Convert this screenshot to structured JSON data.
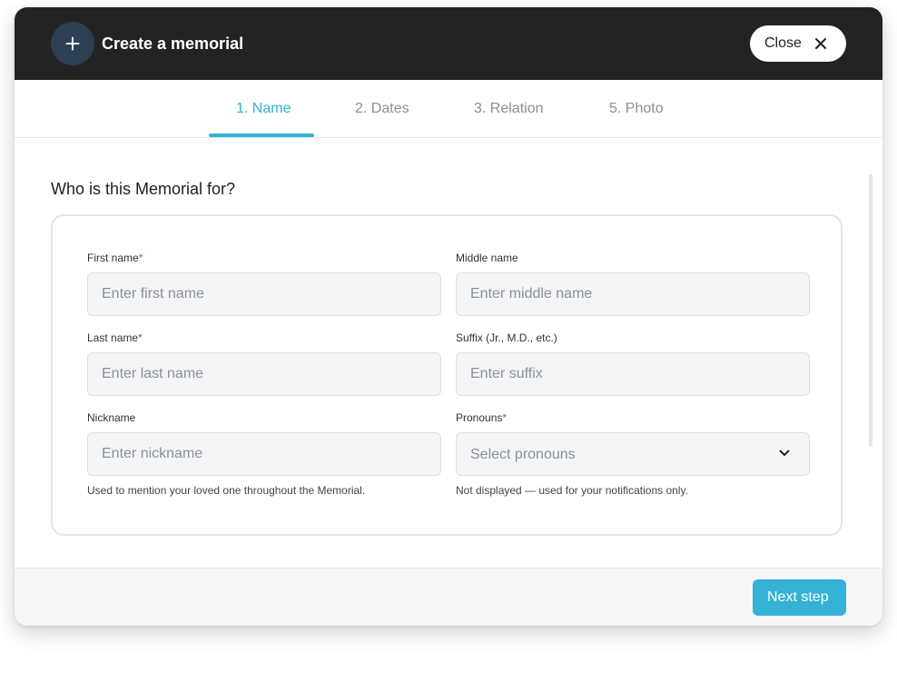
{
  "header": {
    "title": "Create a memorial",
    "add_icon": "plus-icon",
    "close_label": "Close",
    "close_icon": "close-icon"
  },
  "tabs": [
    {
      "label": "1. Name",
      "active": true
    },
    {
      "label": "2. Dates",
      "active": false
    },
    {
      "label": "3. Relation",
      "active": false
    },
    {
      "label": "5. Photo",
      "active": false
    }
  ],
  "form": {
    "title": "Who is this Memorial for?",
    "fields": {
      "first_name": {
        "label": "First name",
        "required_mark": "*",
        "placeholder": "Enter first name",
        "value": ""
      },
      "middle_name": {
        "label": "Middle name",
        "placeholder": "Enter middle name",
        "value": ""
      },
      "last_name": {
        "label": "Last name",
        "required_mark": "*",
        "placeholder": "Enter last name",
        "value": ""
      },
      "suffix": {
        "label": "Suffix (Jr., M.D., etc.)",
        "placeholder": "Enter suffix",
        "value": ""
      },
      "nickname": {
        "label": "Nickname",
        "placeholder": "Enter nickname",
        "value": "",
        "helper": "Used to mention your loved one throughout the Memorial."
      },
      "pronouns": {
        "label": "Pronouns",
        "required_mark": "*",
        "placeholder": "Select pronouns",
        "helper": "Not displayed — used for your notifications only.",
        "icon": "chevron-down-icon"
      }
    }
  },
  "footer": {
    "next_label": "Next step"
  },
  "colors": {
    "accent": "#35b2d6",
    "header_bg": "#232323",
    "required": "#d93a3a"
  }
}
